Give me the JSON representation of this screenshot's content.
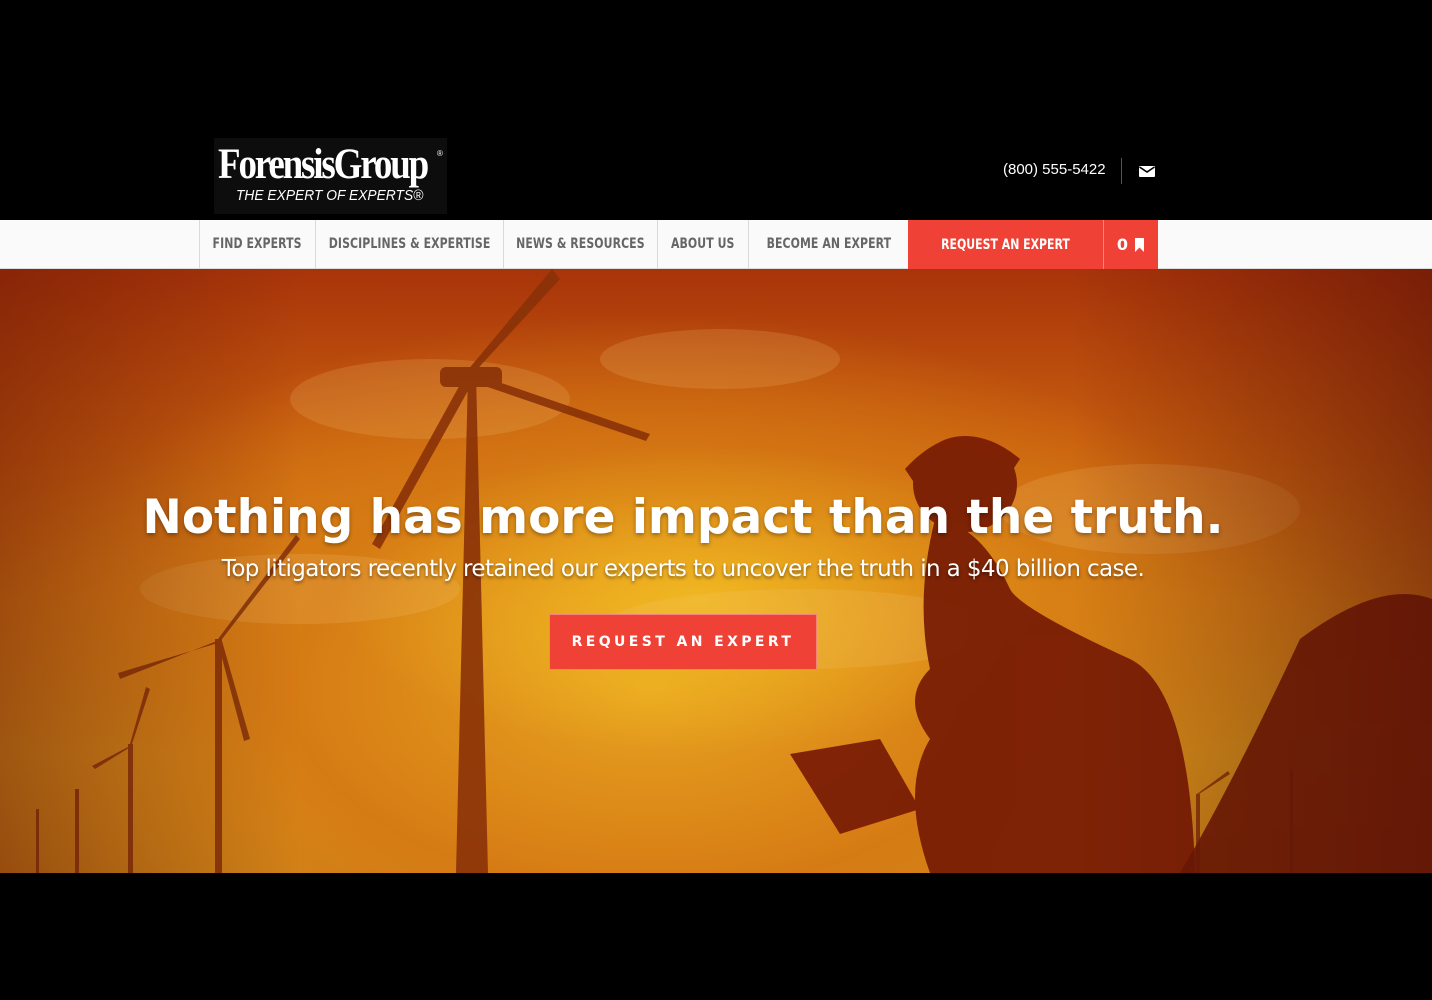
{
  "brand": {
    "name": "ForensisGroup",
    "registered_mark": "®",
    "tagline": "THE EXPERT OF EXPERTS®"
  },
  "header": {
    "phone": "(800) 555-5422",
    "mail_icon": "mail-icon"
  },
  "nav": {
    "items": [
      {
        "label": "FIND EXPERTS"
      },
      {
        "label": "DISCIPLINES & EXPERTISE"
      },
      {
        "label": "NEWS & RESOURCES"
      },
      {
        "label": "ABOUT US"
      },
      {
        "label": "BECOME AN EXPERT"
      }
    ],
    "cta_label": "REQUEST AN EXPERT",
    "bookmark_count": "0",
    "bookmark_icon": "bookmark-icon"
  },
  "hero": {
    "title": "Nothing has more impact than the truth.",
    "subtitle": "Top litigators recently retained our experts to uncover the truth in a $40 billion case.",
    "button_label": "REQUEST AN EXPERT"
  },
  "colors": {
    "accent": "#ef4136",
    "navbar_bg": "#fafafa",
    "nav_text": "#666666",
    "page_bg": "#000000"
  }
}
